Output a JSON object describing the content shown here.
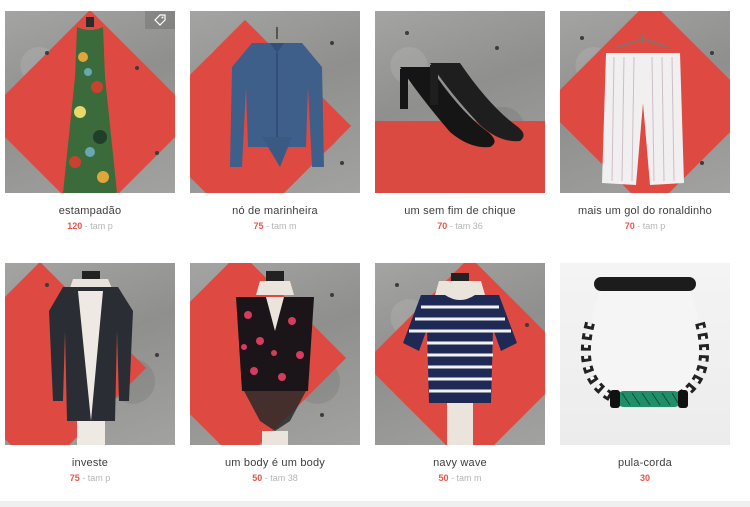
{
  "products": [
    {
      "title": "estampadão",
      "price": "120",
      "size": "- tam p"
    },
    {
      "title": "nó de marinheira",
      "price": "75",
      "size": "- tam m"
    },
    {
      "title": "um sem fim de chique",
      "price": "70",
      "size": "- tam 36"
    },
    {
      "title": "mais um gol do ronaldinho",
      "price": "70",
      "size": "- tam p"
    },
    {
      "title": "investe",
      "price": "75",
      "size": "- tam p"
    },
    {
      "title": "um body é um body",
      "price": "50",
      "size": "- tam 38"
    },
    {
      "title": "navy wave",
      "price": "50",
      "size": "- tam m"
    },
    {
      "title": "pula-corda",
      "price": "30",
      "size": ""
    }
  ],
  "icons": {
    "tag": "tag-icon"
  },
  "colors": {
    "price": "#e8534a",
    "size": "#b4b4b4",
    "accent_red": "#de4a41"
  }
}
